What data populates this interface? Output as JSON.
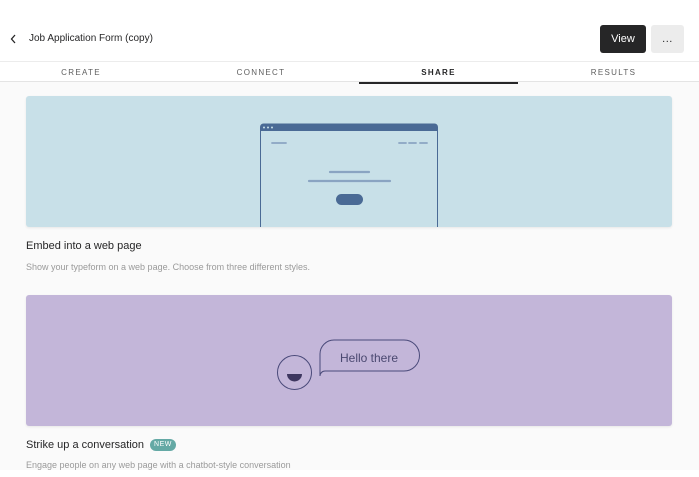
{
  "header": {
    "title": "Job Application Form (copy)",
    "view_label": "View",
    "more_label": "...",
    "back_icon": "chevron-left-icon"
  },
  "tabs": [
    {
      "label": "CREATE",
      "active": false
    },
    {
      "label": "CONNECT",
      "active": false
    },
    {
      "label": "SHARE",
      "active": true
    },
    {
      "label": "RESULTS",
      "active": false
    }
  ],
  "cards": [
    {
      "title": "Embed into a web page",
      "description": "Show your typeform on a web page. Choose from three different styles.",
      "illustration": "browser-window",
      "color": "#c8e0e8"
    },
    {
      "title": "Strike up a conversation",
      "badge": "NEW",
      "description": "Engage people on any web page with a chatbot-style conversation",
      "illustration": "chat-bubble",
      "bubble_text": "Hello there",
      "color": "#c3b6d9"
    }
  ],
  "colors": {
    "accent_dark": "#262627",
    "embed_bg": "#c8e0e8",
    "chat_bg": "#c3b6d9",
    "badge_bg": "#64a9a5",
    "browser_stroke": "#4a6a95"
  }
}
